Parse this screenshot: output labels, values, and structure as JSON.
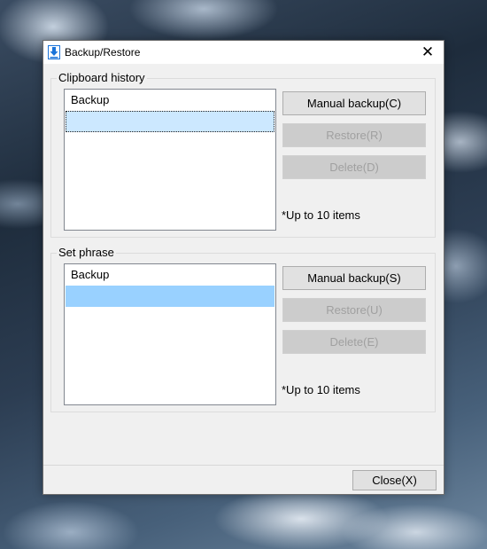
{
  "window": {
    "title": "Backup/Restore",
    "close_glyph": "✕"
  },
  "clipboard_history": {
    "label": "Clipboard history",
    "list": [
      "Backup",
      ""
    ],
    "manual_backup": "Manual backup(C)",
    "restore": "Restore(R)",
    "delete": "Delete(D)",
    "note": "*Up to 10 items"
  },
  "set_phrase": {
    "label": "Set phrase",
    "list": [
      "Backup",
      ""
    ],
    "manual_backup": "Manual backup(S)",
    "restore": "Restore(U)",
    "delete": "Delete(E)",
    "note": "*Up to 10 items"
  },
  "footer": {
    "close": "Close(X)"
  },
  "colors": {
    "icon_blue": "#1a73d9",
    "selection_focus": "#cce8ff",
    "selection": "#99d1ff"
  }
}
